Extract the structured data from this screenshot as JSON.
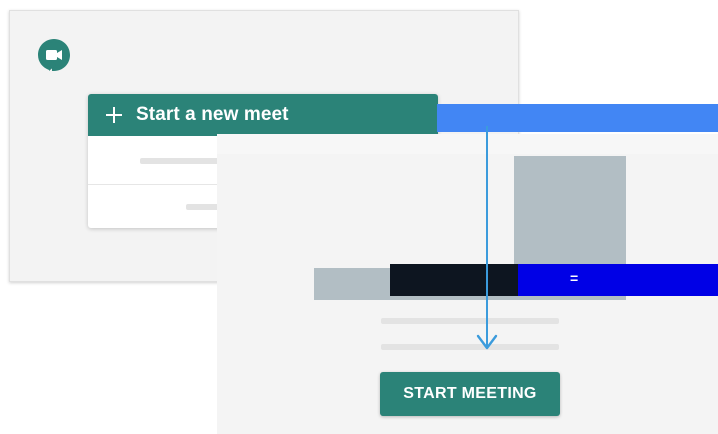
{
  "app": {
    "logo_icon": "google-meet-icon",
    "accent_color": "#2b8378",
    "highlight_color": "#4286f4",
    "arrow_color": "#3b9bdc"
  },
  "menu": {
    "new_meeting_label": "Start a new meet",
    "new_meeting_icon": "plus-icon"
  },
  "meeting_preview": {
    "start_button_label": "START MEETING"
  }
}
